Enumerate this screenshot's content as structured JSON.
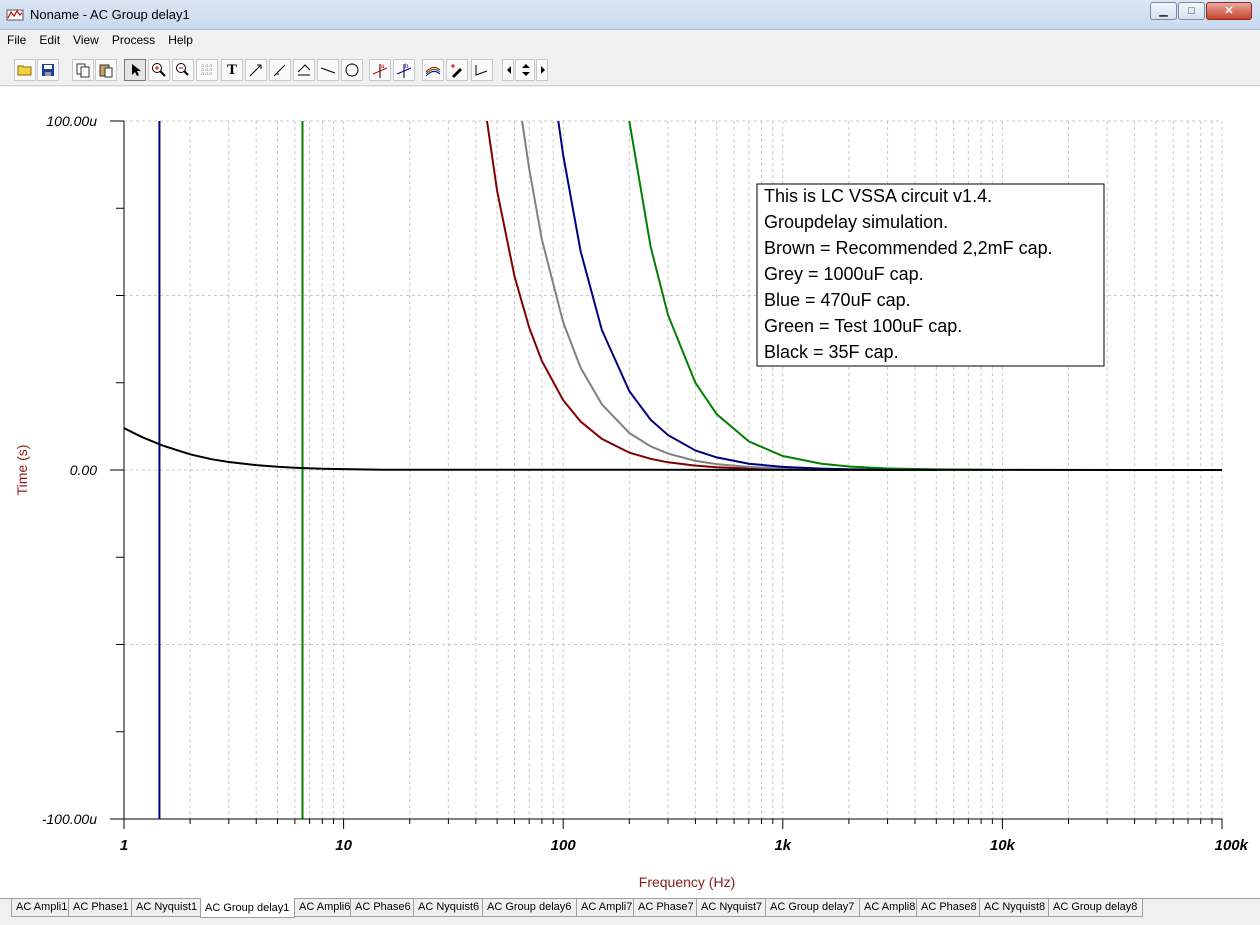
{
  "window": {
    "title": "Noname - AC Group delay1",
    "minimize_glyph": "▁",
    "maximize_glyph": "□",
    "close_glyph": "✕"
  },
  "menu": [
    "File",
    "Edit",
    "View",
    "Process",
    "Help"
  ],
  "toolbar": {
    "icons": [
      "open-folder-icon",
      "save-icon",
      "copy-icon",
      "paste-icon",
      "pointer-icon",
      "zoom-in-icon",
      "zoom-100-icon",
      "grid-icon",
      "text-tool-icon",
      "annotation-tool-icon",
      "annotation-value-icon",
      "annotation-axis-icon",
      "line-tool-icon",
      "circle-tool-icon",
      "cursor-a-icon",
      "cursor-b-icon",
      "curves-icon",
      "pen-icon",
      "segment-icon",
      "scroll-left-icon",
      "scroll-updown-icon",
      "scroll-right-icon"
    ],
    "text_tool_label": "T"
  },
  "colors": {
    "brown": "#800000",
    "grey": "#808080",
    "blue": "#000080",
    "green": "#008000",
    "black": "#000000",
    "axis_label": "#8b1a1a"
  },
  "chart_data": {
    "type": "line",
    "xlabel": "Frequency (Hz)",
    "ylabel": "Time (s)",
    "xscale": "log",
    "xlim": [
      1,
      100000
    ],
    "ylim": [
      -0.0001,
      0.0001
    ],
    "x_tick_labels": [
      "1",
      "10",
      "100",
      "1k",
      "10k",
      "100k"
    ],
    "y_tick_labels": [
      "100.00u",
      "0.00",
      "-100.00u"
    ],
    "grid": true,
    "legend_lines": [
      "This is LC VSSA circuit v1.4.",
      "Groupdelay simulation.",
      "Brown = Recommended 2,2mF cap.",
      "Grey = 1000uF cap.",
      "Blue = 470uF cap.",
      "Green = Test 100uF cap.",
      "Black = 35F cap."
    ],
    "legend_position": "top-right",
    "series": [
      {
        "color": "#800000",
        "x": [
          45,
          50,
          60,
          70,
          80,
          100,
          120,
          150,
          200,
          250,
          300,
          400,
          500,
          700,
          1000,
          1500,
          2000,
          3000
        ],
        "y": [
          0.0001,
          8e-05,
          5.55e-05,
          4.08e-05,
          3.12e-05,
          2e-05,
          1.39e-05,
          8.9e-06,
          5e-06,
          3.2e-06,
          2.2e-06,
          1.25e-06,
          8e-07,
          4e-07,
          2e-07,
          9e-08,
          5e-08,
          2e-08
        ]
      },
      {
        "color": "#808080",
        "x": [
          65,
          70,
          80,
          100,
          120,
          150,
          200,
          250,
          300,
          400,
          500,
          700,
          1000,
          1500,
          2000,
          3000,
          4000
        ],
        "y": [
          0.0001,
          8.63e-05,
          6.6e-05,
          4.23e-05,
          2.93e-05,
          1.88e-05,
          1.06e-05,
          6.8e-06,
          4.7e-06,
          2.6e-06,
          1.7e-06,
          8.6e-07,
          4.2e-07,
          1.9e-07,
          1e-07,
          5e-08,
          3e-08
        ]
      },
      {
        "color": "#000080",
        "x": [
          95,
          100,
          120,
          150,
          200,
          250,
          300,
          400,
          500,
          700,
          1000,
          1500,
          2000,
          3000,
          5000
        ],
        "y": [
          0.0001,
          9.02e-05,
          6.27e-05,
          4.01e-05,
          2.26e-05,
          1.44e-05,
          1e-05,
          5.6e-06,
          3.6e-06,
          1.8e-06,
          9e-07,
          4e-07,
          2.3e-07,
          1e-07,
          4e-08
        ]
      },
      {
        "color": "#008000",
        "x": [
          200,
          250,
          300,
          400,
          500,
          700,
          1000,
          1500,
          2000,
          3000,
          5000,
          9000
        ],
        "y": [
          0.0001,
          6.4e-05,
          4.44e-05,
          2.5e-05,
          1.6e-05,
          8.2e-06,
          4e-06,
          1.8e-06,
          1e-06,
          4.4e-07,
          1.6e-07,
          5e-08
        ]
      },
      {
        "color": "#000000",
        "x": [
          1,
          1.2,
          1.5,
          2,
          2.5,
          3,
          4,
          5,
          6,
          8,
          10,
          15,
          100000
        ],
        "y": [
          1.2e-05,
          9.5e-06,
          7e-06,
          4.5e-06,
          3.1e-06,
          2.3e-06,
          1.4e-06,
          9.3e-07,
          6.6e-07,
          3.8e-07,
          2.5e-07,
          1e-07,
          0
        ]
      }
    ],
    "vertical_markers": [
      {
        "color": "#000080",
        "x": 1.45
      },
      {
        "color": "#008000",
        "x": 6.5
      }
    ]
  },
  "tabs": [
    "AC Ampli1",
    "AC Phase1",
    "AC Nyquist1",
    "AC Group delay1",
    "AC Ampli6",
    "AC Phase6",
    "AC Nyquist6",
    "AC Group delay6",
    "AC Ampli7",
    "AC Phase7",
    "AC Nyquist7",
    "AC Group delay7",
    "AC Ampli8",
    "AC Phase8",
    "AC Nyquist8",
    "AC Group delay8"
  ],
  "active_tab": "AC Group delay1"
}
